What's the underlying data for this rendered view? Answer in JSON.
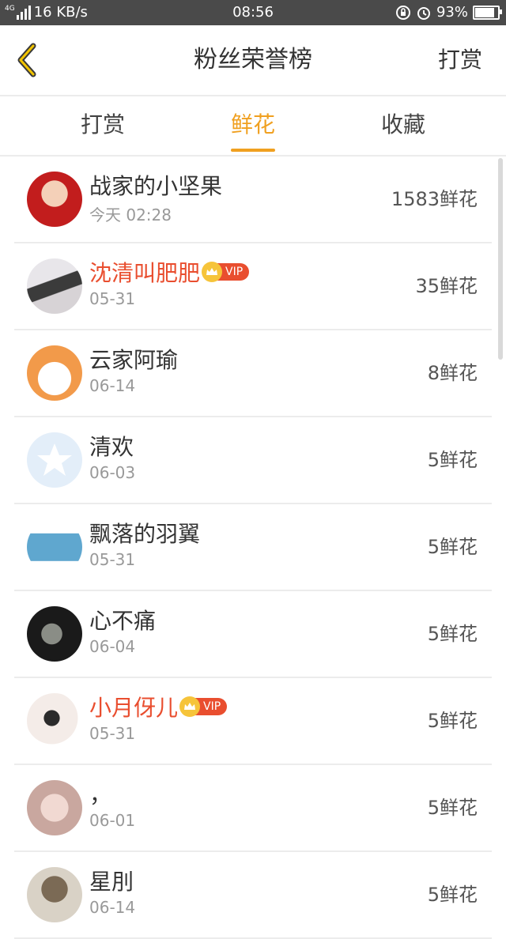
{
  "status_bar": {
    "network": "4G",
    "speed": "16 KB/s",
    "time": "08:56",
    "battery": "93%",
    "battery_level": 0.93
  },
  "header": {
    "title": "粉丝荣誉榜",
    "action": "打赏"
  },
  "tabs": [
    {
      "label": "打赏",
      "active": false
    },
    {
      "label": "鲜花",
      "active": true
    },
    {
      "label": "收藏",
      "active": false
    }
  ],
  "accent_color": "#f0a020",
  "vip_color": "#e94e2f",
  "vip_label": "VIP",
  "list": [
    {
      "name": "战家的小坚果",
      "date": "今天 02:28",
      "score": "1583鲜花",
      "vip": false
    },
    {
      "name": "沈清叫肥肥",
      "date": "05-31",
      "score": "35鲜花",
      "vip": true
    },
    {
      "name": "云家阿瑜",
      "date": "06-14",
      "score": "8鲜花",
      "vip": false
    },
    {
      "name": "清欢",
      "date": "06-03",
      "score": "5鲜花",
      "vip": false
    },
    {
      "name": "飘落的羽翼",
      "date": "05-31",
      "score": "5鲜花",
      "vip": false
    },
    {
      "name": "心不痛",
      "date": "06-04",
      "score": "5鲜花",
      "vip": false
    },
    {
      "name": "小月伢儿",
      "date": "05-31",
      "score": "5鲜花",
      "vip": true
    },
    {
      "name": "，",
      "date": "06-01",
      "score": "5鲜花",
      "vip": false
    },
    {
      "name": "星刖",
      "date": "06-14",
      "score": "5鲜花",
      "vip": false
    }
  ]
}
